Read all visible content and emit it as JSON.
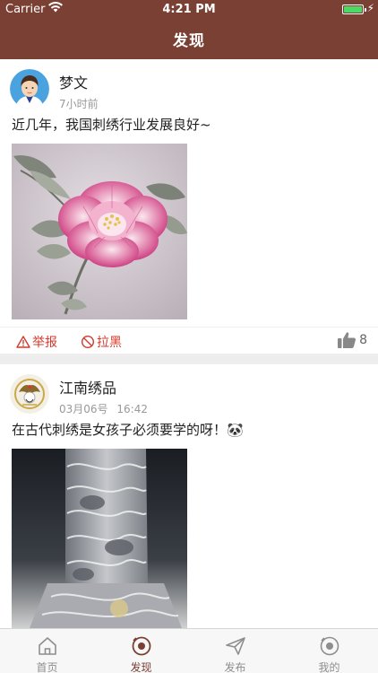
{
  "status_bar": {
    "carrier": "Carrier",
    "time": "4:21 PM"
  },
  "header": {
    "title": "发现"
  },
  "posts": [
    {
      "author": "梦文",
      "time": "7小时前",
      "content": "近几年，我国刺绣行业发展良好~",
      "actions": {
        "report": "举报",
        "block": "拉黑",
        "likes": "8"
      }
    },
    {
      "author": "江南绣品",
      "date": "03月06号",
      "time": "16:42",
      "content": "在古代刺绣是女孩子必须要学的呀！🐼"
    }
  ],
  "tabbar": {
    "items": [
      {
        "label": "首页",
        "icon": "home-icon"
      },
      {
        "label": "发现",
        "icon": "discover-icon",
        "active": true
      },
      {
        "label": "发布",
        "icon": "send-icon"
      },
      {
        "label": "我的",
        "icon": "profile-icon"
      }
    ]
  },
  "colors": {
    "brand": "#7a4034",
    "danger": "#d23a2c",
    "tab_inactive": "#8e8e8e"
  }
}
